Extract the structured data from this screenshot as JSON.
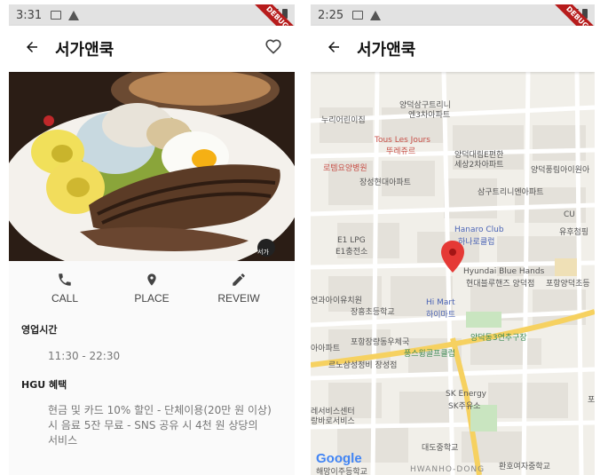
{
  "left_screen": {
    "status": {
      "time": "3:31",
      "debug": "DEBUG"
    },
    "appbar": {
      "title": "서가앤쿡"
    },
    "hero": {
      "watermark": "서가"
    },
    "actions": [
      {
        "label": "CALL",
        "icon": "phone-icon"
      },
      {
        "label": "PLACE",
        "icon": "place-pin-icon"
      },
      {
        "label": "REVEIW",
        "icon": "edit-pencil-icon"
      }
    ],
    "hours": {
      "label": "영업시간",
      "value": "11:30 - 22:30"
    },
    "benefit": {
      "label": "HGU 혜택",
      "lines": [
        "현금 및 카드 10% 할인  - 단체이용(20만 원 이상)",
        "시 음료 5잔 무료  - SNS 공유 시 4천 원 상당의",
        "서비스"
      ]
    }
  },
  "right_screen": {
    "status": {
      "time": "2:25",
      "debug": "DEBUG"
    },
    "appbar": {
      "title": "서가앤쿡"
    },
    "map": {
      "labels": [
        "양덕삼구트리니",
        "엔3차아파트",
        "누리어린이집",
        "Tous Les Jours",
        "뚜레쥬르",
        "양덕대림E편한",
        "세상2차아파트",
        "로템요양병원",
        "양덕풍림아이원아",
        "장성현대아파트",
        "삼구트리니엔아파트",
        "CU",
        "Hanaro Club",
        "하나로클럽",
        "유후첨핑",
        "E1 LPG",
        "E1충전소",
        "Hyundai Blue Hands",
        "현대블루핸즈 양덕점",
        "포항양덕초등",
        "연과아이유치원",
        "Hi Mart",
        "하이마트",
        "장흥초등학교",
        "양덕동3연추구장",
        "포항장량동우체국",
        "아아파트",
        "풍스윙골프클럽",
        "르노삼성정비 장성점",
        "SK Energy",
        "SK주유소",
        "레서비스센터",
        "랑바로서비스",
        "대도중학교",
        "환호여자중학교",
        "해망이주등학교",
        "HWANHO-DONG",
        "포"
      ],
      "logo": "Google"
    }
  }
}
